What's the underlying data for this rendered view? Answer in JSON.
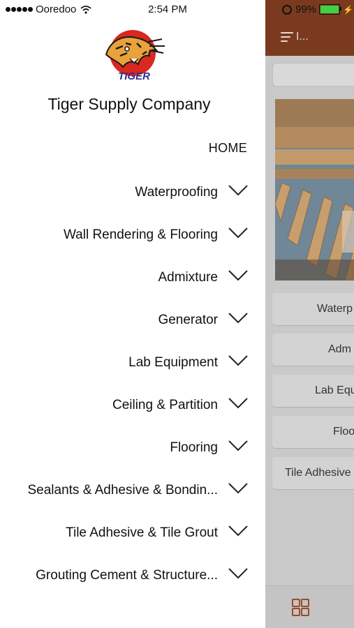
{
  "status_bar": {
    "carrier": "Ooredoo",
    "time": "2:54 PM",
    "battery": "99%"
  },
  "drawer": {
    "company_name": "Tiger Supply Company",
    "logo_text": "TIGER",
    "home": "HOME",
    "items": [
      {
        "label": "Waterproofing"
      },
      {
        "label": "Wall Rendering & Flooring"
      },
      {
        "label": "Admixture"
      },
      {
        "label": "Generator"
      },
      {
        "label": "Lab Equipment"
      },
      {
        "label": "Ceiling & Partition"
      },
      {
        "label": "Flooring"
      },
      {
        "label": "Sealants & Adhesive & Bondin..."
      },
      {
        "label": "Tile Adhesive & Tile Grout"
      },
      {
        "label": "Grouting Cement & Structure..."
      }
    ]
  },
  "background_app": {
    "menu_text": "I...",
    "categories": [
      "Waterp",
      "Adm",
      "Lab Equ",
      "Floo",
      "Tile Adhesive"
    ]
  },
  "colors": {
    "header": "#7a3a1f",
    "accent": "#9a4b2a",
    "battery": "#3fd13f"
  }
}
